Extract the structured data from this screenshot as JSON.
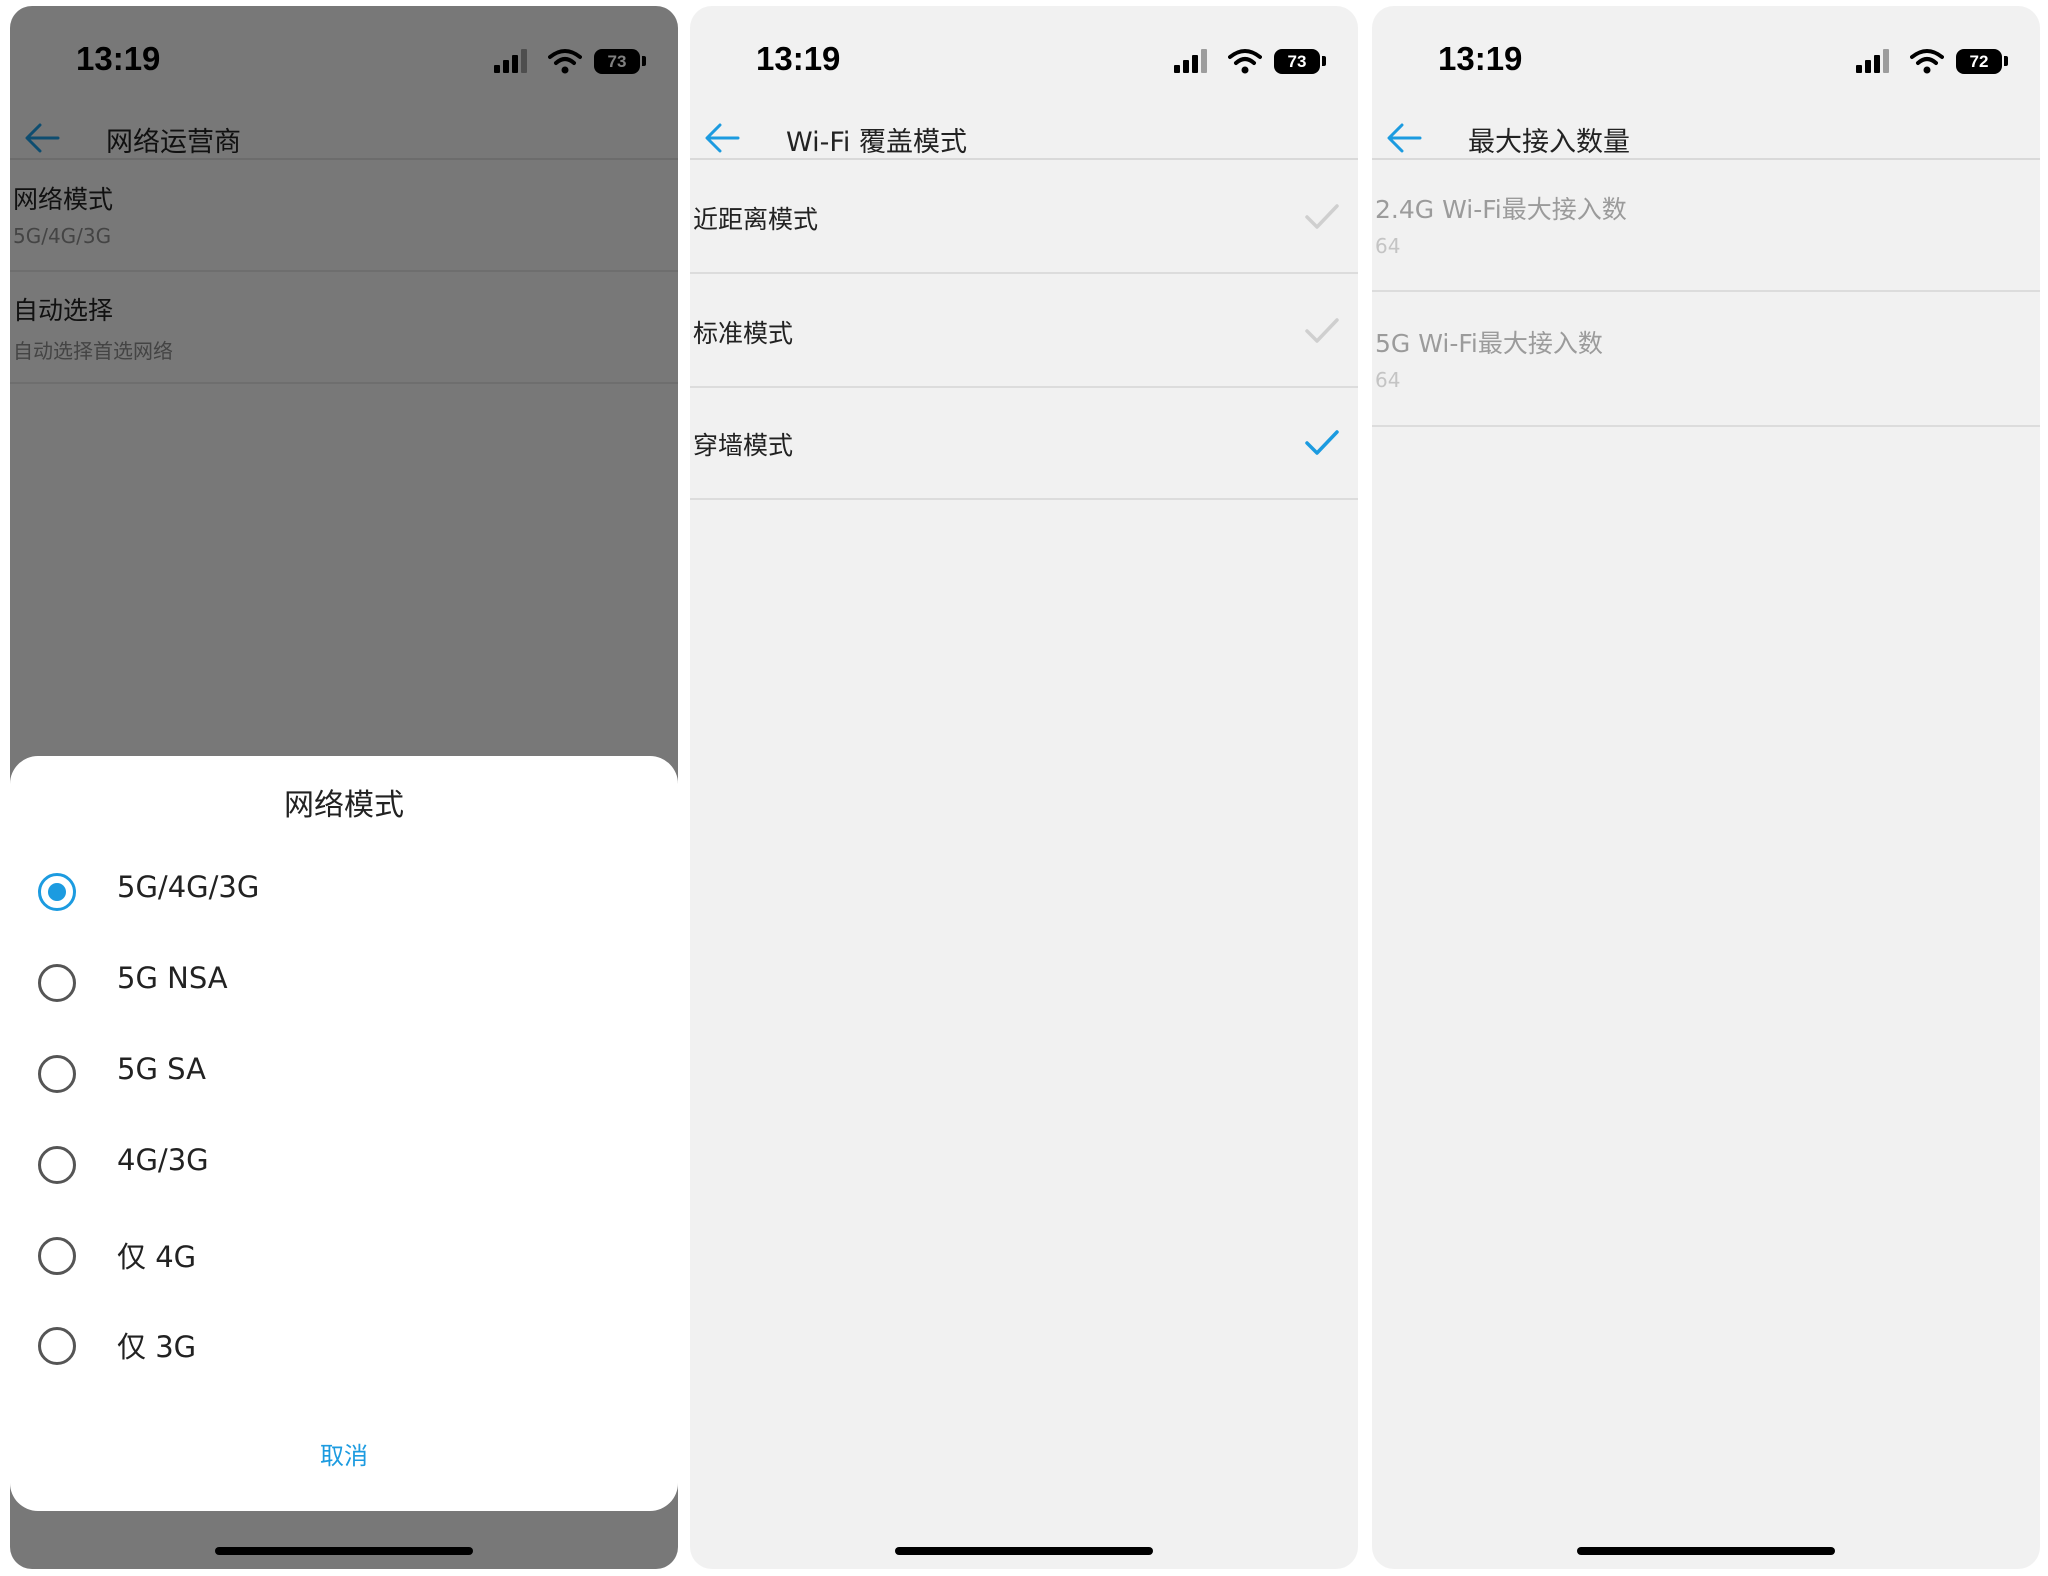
{
  "colors": {
    "accent": "#1c9be0",
    "text": "#222222",
    "subtext": "#888888",
    "disabled": "#9b9b9b",
    "background": "#f1f1f1"
  },
  "panel1": {
    "status": {
      "time": "13:19",
      "battery": "73"
    },
    "nav": {
      "title": "网络运营商"
    },
    "items": [
      {
        "title": "网络模式",
        "subtitle": "5G/4G/3G"
      },
      {
        "title": "自动选择",
        "subtitle": "自动选择首选网络"
      }
    ],
    "sheet": {
      "title": "网络模式",
      "selected_index": 0,
      "options": [
        "5G/4G/3G",
        "5G NSA",
        "5G SA",
        "4G/3G",
        "仅 4G",
        "仅 3G"
      ],
      "cancel_label": "取消"
    }
  },
  "panel2": {
    "status": {
      "time": "13:19",
      "battery": "73"
    },
    "nav": {
      "title": "Wi-Fi 覆盖模式"
    },
    "items": [
      {
        "label": "近距离模式",
        "checked": false
      },
      {
        "label": "标准模式",
        "checked": false
      },
      {
        "label": "穿墙模式",
        "checked": true
      }
    ]
  },
  "panel3": {
    "status": {
      "time": "13:19",
      "battery": "72"
    },
    "nav": {
      "title": "最大接入数量"
    },
    "items": [
      {
        "title": "2.4G Wi-Fi最大接入数",
        "value": "64"
      },
      {
        "title": "5G Wi-Fi最大接入数",
        "value": "64"
      }
    ]
  },
  "icons": {
    "back": "arrow-left-icon",
    "cellular": "cellular-signal-icon",
    "wifi": "wifi-signal-icon",
    "battery": "battery-icon",
    "check": "checkmark-icon"
  }
}
